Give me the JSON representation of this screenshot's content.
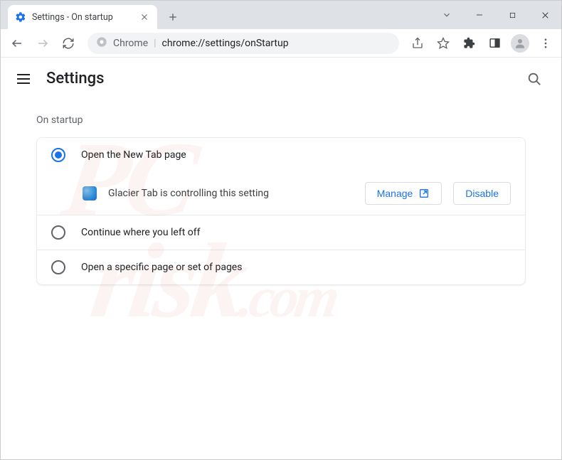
{
  "window": {
    "tab_title": "Settings - On startup"
  },
  "toolbar": {
    "chrome_label": "Chrome",
    "url": "chrome://settings/onStartup"
  },
  "settings": {
    "title": "Settings",
    "section_label": "On startup",
    "options": [
      {
        "label": "Open the New Tab page",
        "checked": true
      },
      {
        "label": "Continue where you left off",
        "checked": false
      },
      {
        "label": "Open a specific page or set of pages",
        "checked": false
      }
    ],
    "extension_notice": "Glacier Tab is controlling this setting",
    "manage_label": "Manage",
    "disable_label": "Disable"
  },
  "watermark": {
    "line1": "PC",
    "line2": "risk",
    "suffix": ".com"
  }
}
